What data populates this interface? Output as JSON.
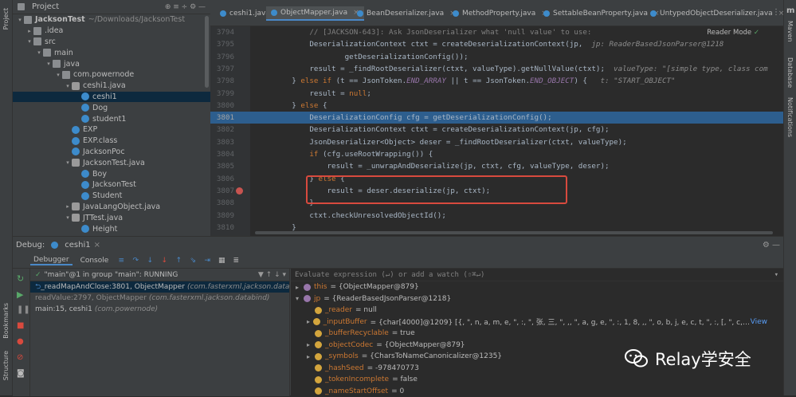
{
  "tool_windows": {
    "left": [
      "Project",
      "Bookmarks",
      "Structure"
    ],
    "right": [
      "Maven",
      "Database",
      "Notifications"
    ],
    "right_icon": "m"
  },
  "project": {
    "title": "Project",
    "tree": [
      {
        "label": "JacksonTest",
        "hint": "~/Downloads/JacksonTest",
        "depth": 0,
        "icon": "folder",
        "expanded": true,
        "bold": true
      },
      {
        "label": ".idea",
        "depth": 1,
        "icon": "folder",
        "expanded": false
      },
      {
        "label": "src",
        "depth": 1,
        "icon": "folder",
        "expanded": true
      },
      {
        "label": "main",
        "depth": 2,
        "icon": "folder",
        "expanded": true
      },
      {
        "label": "java",
        "depth": 3,
        "icon": "folder",
        "expanded": true
      },
      {
        "label": "com.powernode",
        "depth": 4,
        "icon": "pkg",
        "expanded": true
      },
      {
        "label": "ceshi1.java",
        "depth": 5,
        "icon": "file",
        "expanded": true
      },
      {
        "label": "ceshi1",
        "depth": 6,
        "icon": "cls",
        "selected": true
      },
      {
        "label": "Dog",
        "depth": 6,
        "icon": "cls"
      },
      {
        "label": "student1",
        "depth": 6,
        "icon": "cls"
      },
      {
        "label": "EXP",
        "depth": 5,
        "icon": "cls"
      },
      {
        "label": "EXP.class",
        "depth": 5,
        "icon": "cls"
      },
      {
        "label": "JacksonPoc",
        "depth": 5,
        "icon": "cls"
      },
      {
        "label": "JacksonTest.java",
        "depth": 5,
        "icon": "file",
        "expanded": true
      },
      {
        "label": "Boy",
        "depth": 6,
        "icon": "cls"
      },
      {
        "label": "JacksonTest",
        "depth": 6,
        "icon": "cls"
      },
      {
        "label": "Student",
        "depth": 6,
        "icon": "cls"
      },
      {
        "label": "JavaLangObject.java",
        "depth": 5,
        "icon": "file",
        "expanded": false
      },
      {
        "label": "JTTest.java",
        "depth": 5,
        "icon": "file",
        "expanded": true
      },
      {
        "label": "Height",
        "depth": 6,
        "icon": "cls"
      }
    ]
  },
  "tabs": [
    {
      "label": "ceshi1.java",
      "active": false
    },
    {
      "label": "ObjectMapper.java",
      "active": true
    },
    {
      "label": "BeanDeserializer.java",
      "active": false
    },
    {
      "label": "MethodProperty.java",
      "active": false
    },
    {
      "label": "SettableBeanProperty.java",
      "active": false
    },
    {
      "label": "UntypedObjectDeserializer.java",
      "active": false
    }
  ],
  "editor": {
    "reader_mode": "Reader Mode",
    "current_line": "3801",
    "breakpoint_line": "3807",
    "lines": [
      {
        "num": "3794",
        "parts": [
          {
            "t": "            // [JACKSON-643]: Ask JsonDeserializer what 'null value' to use:",
            "c": "c-cm"
          }
        ]
      },
      {
        "num": "3795",
        "parts": [
          {
            "t": "            DeserializationContext ctxt = createDeserializationContext(jp,  ",
            "c": ""
          },
          {
            "t": "jp: ReaderBasedJsonParser@1218",
            "c": "c-hint"
          }
        ]
      },
      {
        "num": "3796",
        "parts": [
          {
            "t": "                    getDeserializationConfig());",
            "c": ""
          }
        ]
      },
      {
        "num": "3797",
        "parts": [
          {
            "t": "            result = _findRootDeserializer(ctxt, valueType).getNullValue(ctxt);  ",
            "c": ""
          },
          {
            "t": "valueType: \"[simple type, class com",
            "c": "c-hint"
          }
        ]
      },
      {
        "num": "3798",
        "parts": [
          {
            "t": "        } ",
            "c": ""
          },
          {
            "t": "else if",
            "c": "c-kw"
          },
          {
            "t": " (t == JsonToken.",
            "c": ""
          },
          {
            "t": "END_ARRAY",
            "c": "c-it"
          },
          {
            "t": " || t == JsonToken.",
            "c": ""
          },
          {
            "t": "END_OBJECT",
            "c": "c-it"
          },
          {
            "t": ") {   ",
            "c": ""
          },
          {
            "t": "t: \"START_OBJECT\"",
            "c": "c-hint"
          }
        ]
      },
      {
        "num": "3799",
        "parts": [
          {
            "t": "            result = ",
            "c": ""
          },
          {
            "t": "null",
            "c": "c-kw"
          },
          {
            "t": ";",
            "c": ""
          }
        ]
      },
      {
        "num": "3800",
        "parts": [
          {
            "t": "        } ",
            "c": ""
          },
          {
            "t": "else",
            "c": "c-kw"
          },
          {
            "t": " {",
            "c": ""
          }
        ]
      },
      {
        "num": "3801",
        "parts": [
          {
            "t": "            DeserializationConfig cfg = getDeserializationConfig();",
            "c": ""
          }
        ]
      },
      {
        "num": "3802",
        "parts": [
          {
            "t": "            DeserializationContext ctxt = createDeserializationContext(jp, cfg);",
            "c": ""
          }
        ]
      },
      {
        "num": "3803",
        "parts": [
          {
            "t": "            JsonDeserializer<Object> deser = _findRootDeserializer(ctxt, valueType);",
            "c": ""
          }
        ]
      },
      {
        "num": "3804",
        "parts": [
          {
            "t": "            ",
            "c": ""
          },
          {
            "t": "if",
            "c": "c-kw"
          },
          {
            "t": " (cfg.useRootWrapping()) {",
            "c": ""
          }
        ]
      },
      {
        "num": "3805",
        "parts": [
          {
            "t": "                result = _unwrapAndDeserialize(jp, ctxt, cfg, valueType, deser);",
            "c": ""
          }
        ]
      },
      {
        "num": "3806",
        "parts": [
          {
            "t": "            } ",
            "c": ""
          },
          {
            "t": "else",
            "c": "c-kw"
          },
          {
            "t": " {",
            "c": ""
          }
        ]
      },
      {
        "num": "3807",
        "parts": [
          {
            "t": "                result = deser.deserialize(jp, ctxt);",
            "c": ""
          }
        ]
      },
      {
        "num": "3808",
        "parts": [
          {
            "t": "            }",
            "c": ""
          }
        ]
      },
      {
        "num": "3809",
        "parts": [
          {
            "t": "            ctxt.checkUnresolvedObjectId();",
            "c": ""
          }
        ]
      },
      {
        "num": "3810",
        "parts": [
          {
            "t": "        }",
            "c": ""
          }
        ]
      }
    ]
  },
  "debug": {
    "label": "Debug:",
    "session": "ceshi1",
    "tabs": [
      "Debugger",
      "Console"
    ],
    "thread": "\"main\"@1 in group \"main\": RUNNING",
    "frames": [
      {
        "method": "_readMapAndClose:3801, ObjectMapper",
        "pkg": "(com.fasterxml.jackson.databind)",
        "selected": true
      },
      {
        "method": "readValue:2797, ObjectMapper",
        "pkg": "(com.fasterxml.jackson.databind)",
        "dim": true
      },
      {
        "method": "main:15, ceshi1",
        "pkg": "(com.powernode)"
      }
    ],
    "eval_placeholder": "Evaluate expression (↵) or add a watch (⇧⌘↵)",
    "variables": [
      {
        "indent": 0,
        "toggle": "▸",
        "icon": "p",
        "name": "this",
        "value": "= {ObjectMapper@879}"
      },
      {
        "indent": 0,
        "toggle": "▾",
        "icon": "p",
        "name": "jp",
        "value": "= {ReaderBasedJsonParser@1218}"
      },
      {
        "indent": 1,
        "toggle": "",
        "icon": "f",
        "name": "_reader",
        "value": "= null"
      },
      {
        "indent": 1,
        "toggle": "▸",
        "icon": "f",
        "name": "_inputBuffer",
        "value": "= {char[4000]@1209} [{, \", n, a, m, e, \", :, \", 张, 三, \", ,, \", a, g, e, \", :, 1, 8, ,, \", o, b, j, e, c, t, \", :, [, \", c, o, m, ., p, o, w, e, r, n, o, d, e, ., ...",
        "extra": "View"
      },
      {
        "indent": 1,
        "toggle": "",
        "icon": "f",
        "name": "_bufferRecyclable",
        "value": "= true"
      },
      {
        "indent": 1,
        "toggle": "▸",
        "icon": "f",
        "name": "_objectCodec",
        "value": "= {ObjectMapper@879}"
      },
      {
        "indent": 1,
        "toggle": "▸",
        "icon": "f",
        "name": "_symbols",
        "value": "= {CharsToNameCanonicalizer@1235}"
      },
      {
        "indent": 1,
        "toggle": "",
        "icon": "f",
        "name": "_hashSeed",
        "value": "= -978470773"
      },
      {
        "indent": 1,
        "toggle": "",
        "icon": "f",
        "name": "_tokenIncomplete",
        "value": "= false"
      },
      {
        "indent": 1,
        "toggle": "",
        "icon": "f",
        "name": "_nameStartOffset",
        "value": "= 0"
      }
    ]
  },
  "watermark": {
    "text": "Relay学安全"
  }
}
